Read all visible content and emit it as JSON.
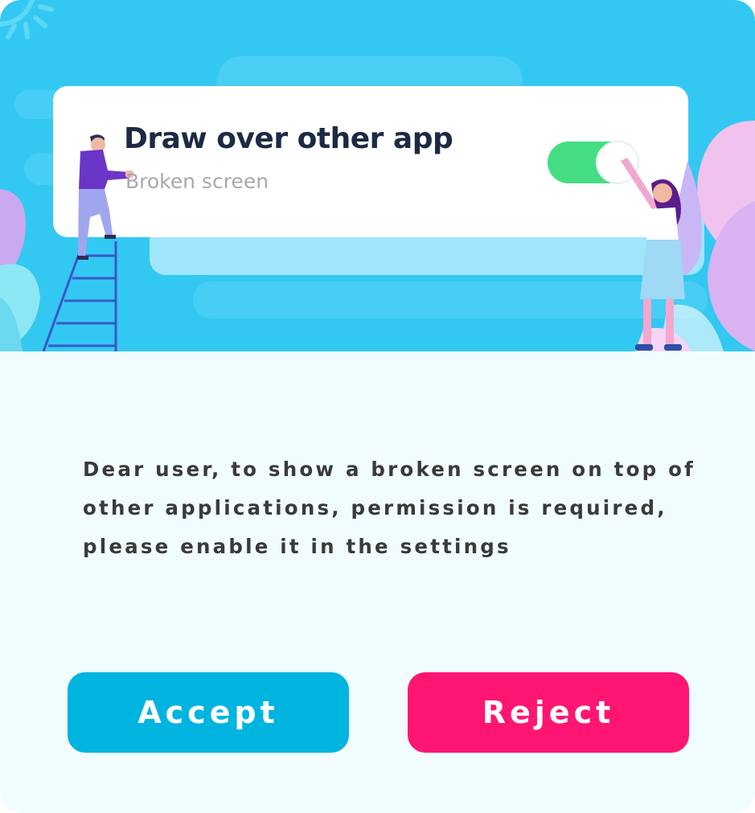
{
  "illustration": {
    "card_title": "Draw over other app",
    "card_subtitle": "Broken screen",
    "toggle_state": "on",
    "icons": [
      "sun-rays-icon",
      "toggle-switch-icon",
      "man-on-ladder-figure",
      "woman-pointing-figure",
      "leaf-decoration-icon"
    ]
  },
  "dialog": {
    "message": "Dear user, to show a broken screen on top of other applications, permission is required, please enable it in the settings"
  },
  "buttons": {
    "accept_label": "Accept",
    "reject_label": "Reject"
  },
  "colors": {
    "hero_background": "#33c8f2",
    "dialog_background": "#f1fcfe",
    "accept_button": "#00b4e0",
    "reject_button": "#ff1572",
    "toggle_on": "#44dd84"
  }
}
